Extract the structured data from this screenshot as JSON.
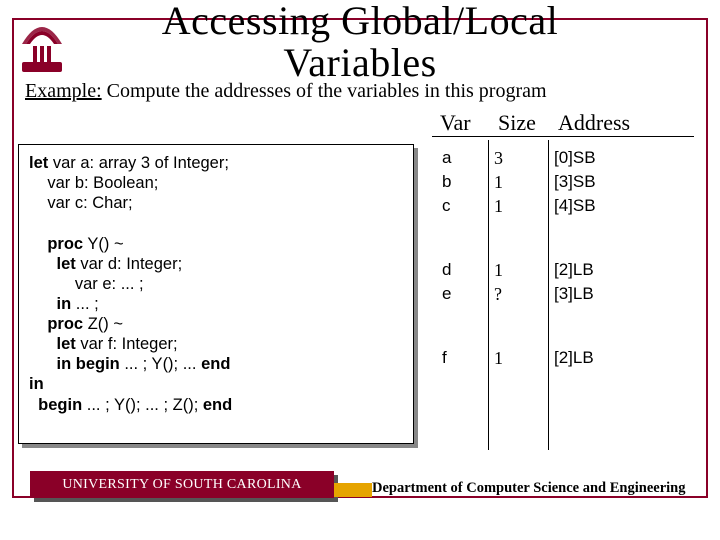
{
  "title_line1": "Accessing Global/Local",
  "title_line2": "Variables",
  "example_label": "Example:",
  "example_text": " Compute the addresses of the variables in this program",
  "headers": {
    "var": "Var",
    "size": "Size",
    "addr": "Address"
  },
  "code": "let var a: array 3 of Integer;\n    var b: Boolean;\n    var c: Char;\n\n    proc Y() ~\n      let var d: Integer;\n          var e: ... ;\n      in ... ;\n    proc Z() ~\n      let var f: Integer;\n      in begin ... ; Y(); ... end\nin\n  begin ... ; Y(); ... ; Z(); end",
  "table": {
    "group1": [
      {
        "var": "a",
        "size": "3",
        "addr": "[0]SB"
      },
      {
        "var": "b",
        "size": "1",
        "addr": "[3]SB"
      },
      {
        "var": "c",
        "size": "1",
        "addr": "[4]SB"
      }
    ],
    "group2": [
      {
        "var": "d",
        "size": "1",
        "addr": "[2]LB"
      },
      {
        "var": "e",
        "size": "?",
        "addr": "[3]LB"
      }
    ],
    "group3": [
      {
        "var": "f",
        "size": "1",
        "addr": "[2]LB"
      }
    ]
  },
  "footer": {
    "university": "UNIVERSITY OF SOUTH CAROLINA",
    "department": "Department of Computer Science and Engineering"
  }
}
